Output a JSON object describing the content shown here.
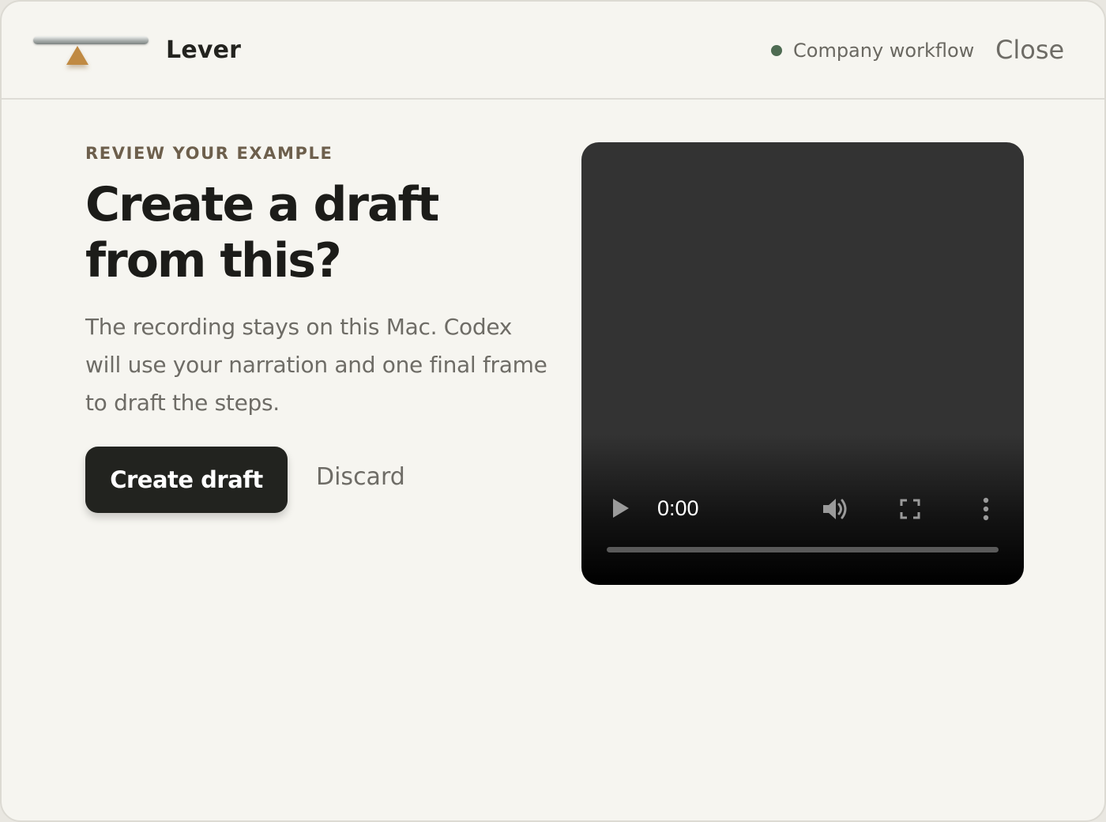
{
  "header": {
    "app_name": "Lever",
    "status_label": "Company workflow",
    "close_label": "Close"
  },
  "main": {
    "eyebrow": "REVIEW YOUR EXAMPLE",
    "title": "Create a draft from this?",
    "body": "The recording stays on this Mac. Codex will use your narration and one final frame to draft the steps.",
    "create_label": "Create draft",
    "discard_label": "Discard"
  },
  "video": {
    "time": "0:00",
    "progress": 0
  },
  "colors": {
    "background": "#f6f5f0",
    "primary_button": "#22231f",
    "status_dot": "#4e6b52",
    "eyebrow": "#6d5f4c",
    "logo_fulcrum": "#c08a43"
  },
  "icons": [
    "lever-logo-icon",
    "status-dot-icon",
    "play-icon",
    "volume-icon",
    "fullscreen-icon",
    "more-options-icon"
  ]
}
